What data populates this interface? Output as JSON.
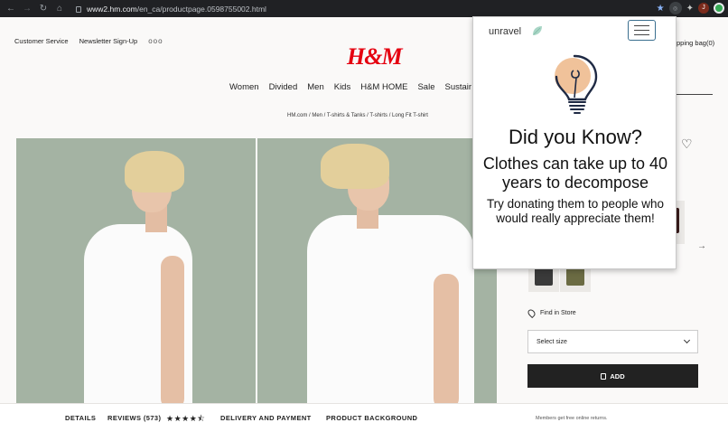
{
  "browser": {
    "url_host": "www2.hm.com",
    "url_path": "/en_ca/productpage.0598755002.html",
    "profile_initial": "J",
    "icons": [
      "back-icon",
      "forward-icon",
      "reload-icon",
      "home-icon",
      "lock-icon",
      "bookmark-star-icon",
      "extension-icon",
      "puzzle-icon",
      "profile-avatar",
      "sync-icon"
    ]
  },
  "header": {
    "customer_service": "Customer Service",
    "newsletter": "Newsletter Sign-Up",
    "more": "ooo",
    "logo": "H&M",
    "shopping_bag": "pping bag(0)"
  },
  "nav": {
    "items": [
      "Women",
      "Divided",
      "Men",
      "Kids",
      "H&M HOME",
      "Sale",
      "Sustair"
    ]
  },
  "breadcrumb": "HM.com / Men / T-shirts & Tanks / T-shirts / Long Fit T-shirt",
  "product": {
    "find_in_store": "Find in Store",
    "select_size": "Select size",
    "add_label": "ADD",
    "swatches": [
      {
        "color": "#3a3a3a"
      },
      {
        "color": "#6b6b43"
      }
    ]
  },
  "tabs": {
    "details": "DETAILS",
    "reviews": "REVIEWS (573)",
    "stars": "★★★★⯪",
    "delivery": "DELIVERY AND PAYMENT",
    "background": "PRODUCT BACKGROUND",
    "returns": "Members get free online returns."
  },
  "popup": {
    "brand": "unravel",
    "title": "Did you Know?",
    "fact": "Clothes can take up to 40 years to decompose",
    "tip": "Try donating them to people who would really appreciate them!"
  },
  "colors": {
    "brand_red": "#e50010",
    "photo_bg": "#a4b3a3",
    "bulb_orange": "#f0c29a",
    "menu_border": "#3b6f8f"
  }
}
